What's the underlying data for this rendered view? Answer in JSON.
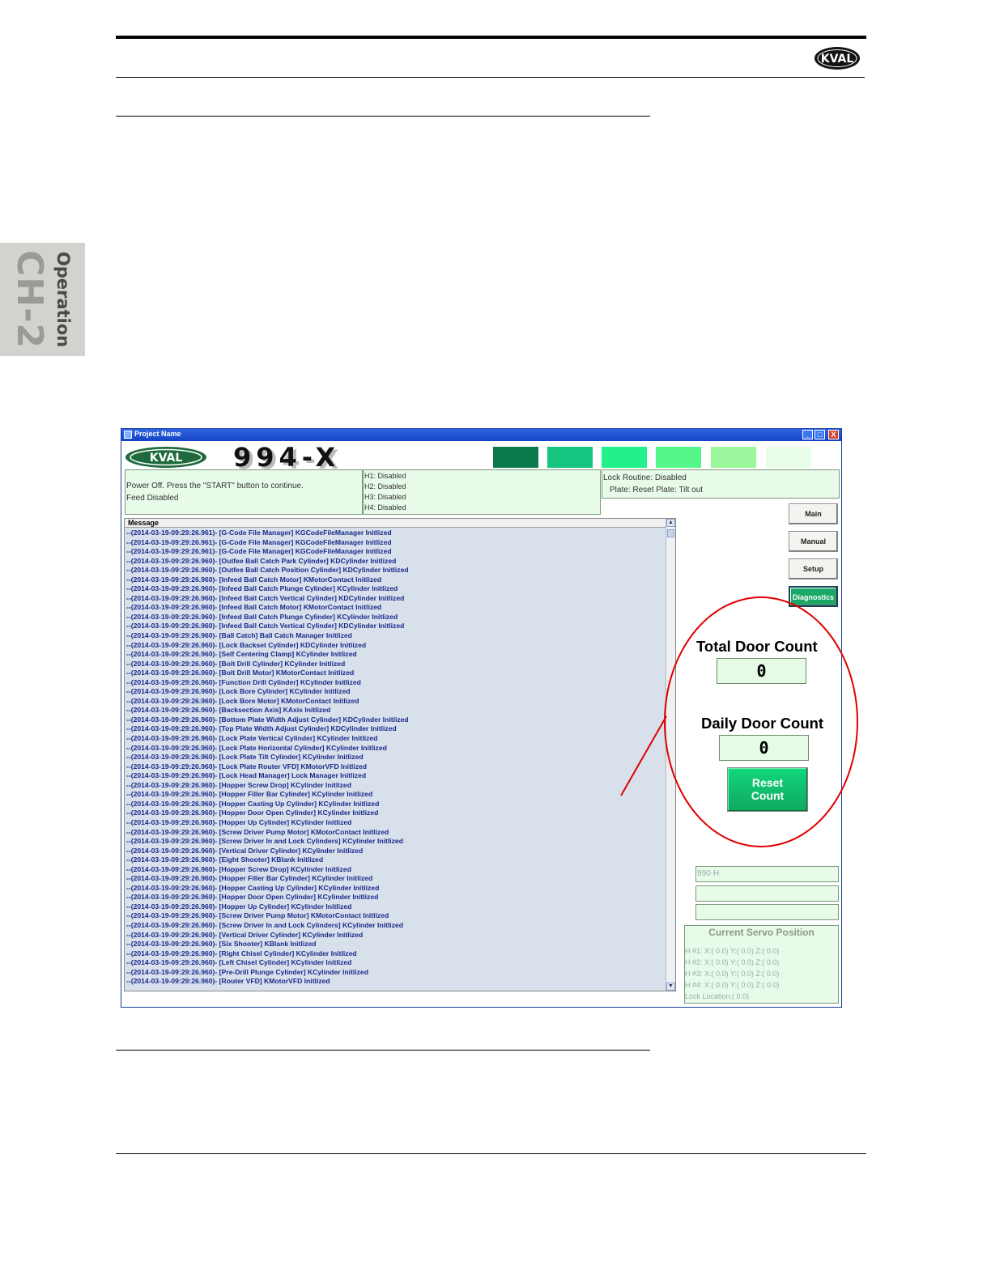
{
  "header": {
    "brand": "KVAL"
  },
  "side_tab": {
    "chapter": "CH-2",
    "section": "Operation"
  },
  "app": {
    "window_title": "Project Name",
    "brand": "KVAL",
    "model": "994-X",
    "swatch_colors": [
      "#0b7a4a",
      "#14c580",
      "#22f08a",
      "#56f78a",
      "#9cf79c",
      "#e8fde8"
    ],
    "window_controls": {
      "minimize": "_",
      "maximize": "□",
      "close": "X"
    },
    "status": {
      "line1": "Power Off. Press the \"START\" button to continue.",
      "line2": "Feed Disabled"
    },
    "heads": [
      "H1: Disabled",
      "H2: Disabled",
      "H3: Disabled",
      "H4: Disabled"
    ],
    "lock": {
      "line1": "Lock Routine: Disabled",
      "line2": "Plate: Reset Plate: Tilt out"
    },
    "message_header": "Message",
    "messages": [
      "--(2014-03-19-09:29:26.961)- [G-Code File Manager] KGCodeFileManager Initlized",
      "--(2014-03-19-09:29:26.961)- [G-Code File Manager] KGCodeFileManager Initlized",
      "--(2014-03-19-09:29:26.961)- [G-Code File Manager] KGCodeFileManager Initlized",
      "--(2014-03-19-09:29:26.960)- [Outfee Ball Catch Park Cylinder] KDCylinder Initlized",
      "--(2014-03-19-09:29:26.960)- [Outfee Ball Catch Position Cylinder] KDCylinder Initlized",
      "--(2014-03-19-09:29:26.960)- [Infeed Ball Catch Motor] KMotorContact Initlized",
      "--(2014-03-19-09:29:26.960)- [Infeed Ball Catch Plunge Cylinder] KCylinder Initlized",
      "--(2014-03-19-09:29:26.960)- [Infeed Ball Catch Vertical Cylinder] KDCylinder Initlized",
      "--(2014-03-19-09:29:26.960)- [Infeed Ball Catch Motor] KMotorContact Initlized",
      "--(2014-03-19-09:29:26.960)- [Infeed Ball Catch Plunge Cylinder] KCylinder Initlized",
      "--(2014-03-19-09:29:26.960)- [Infeed Ball Catch Vertical Cylinder] KDCylinder Initlized",
      "--(2014-03-19-09:29:26.960)- [Ball Catch] Ball Catch Manager Initlized",
      "--(2014-03-19-09:29:26.960)- [Lock Backset Cylinder] KDCylinder Initlized",
      "--(2014-03-19-09:29:26.960)- [Self Centering Clamp] KCylinder Initlized",
      "--(2014-03-19-09:29:26.960)- [Bolt Drill Cylinder] KCylinder Initlized",
      "--(2014-03-19-09:29:26.960)- [Bolt Drill Motor] KMotorContact Initlized",
      "--(2014-03-19-09:29:26.960)- [Function Drill Cylinder] KCylinder Initlized",
      "--(2014-03-19-09:29:26.960)- [Lock Bore Cylinder] KCylinder Initlized",
      "--(2014-03-19-09:29:26.960)- [Lock Bore Motor] KMotorContact Initlized",
      "--(2014-03-19-09:29:26.960)- [Backsection Axis] KAxis Initlized",
      "--(2014-03-19-09:29:26.960)- [Bottom Plate Width Adjust Cylinder] KDCylinder Initlized",
      "--(2014-03-19-09:29:26.960)- [Top Plate Width Adjust Cylinder] KDCylinder Initlized",
      "--(2014-03-19-09:29:26.960)- [Lock Plate Vertical Cylinder] KCylinder Initlized",
      "--(2014-03-19-09:29:26.960)- [Lock Plate Horizontal Cylinder] KCylinder Initlized",
      "--(2014-03-19-09:29:26.960)- [Lock Plate Tilt Cylinder] KCylinder Initlized",
      "--(2014-03-19-09:29:26.960)- [Lock Plate Router VFD] KMotorVFD Initlized",
      "--(2014-03-19-09:29:26.960)- [Lock Head Manager] Lock Manager Initlized",
      "--(2014-03-19-09:29:26.960)- [Hopper Screw Drop] KCylinder Initlized",
      "--(2014-03-19-09:29:26.960)- [Hopper Filler Bar Cylinder] KCylinder Initlized",
      "--(2014-03-19-09:29:26.960)- [Hopper Casting Up Cylinder] KCylinder Initlized",
      "--(2014-03-19-09:29:26.960)- [Hopper Door Open Cylinder] KCylinder Initlized",
      "--(2014-03-19-09:29:26.960)- [Hopper Up Cylinder] KCylinder Initlized",
      "--(2014-03-19-09:29:26.960)- [Screw Driver Pump Motor] KMotorContact Initlized",
      "--(2014-03-19-09:29:26.960)- [Screw Driver In and Lock Cylinders] KCylinder Initlized",
      "--(2014-03-19-09:29:26.960)- [Vertical Driver Cylinder] KCylinder Initlized",
      "--(2014-03-19-09:29:26.960)- [Eight Shooter] KBlank Initlized",
      "--(2014-03-19-09:29:26.960)- [Hopper Screw Drop] KCylinder Initlized",
      "--(2014-03-19-09:29:26.960)- [Hopper Filler Bar Cylinder] KCylinder Initlized",
      "--(2014-03-19-09:29:26.960)- [Hopper Casting Up Cylinder] KCylinder Initlized",
      "--(2014-03-19-09:29:26.960)- [Hopper Door Open Cylinder] KCylinder Initlized",
      "--(2014-03-19-09:29:26.960)- [Hopper Up Cylinder] KCylinder Initlized",
      "--(2014-03-19-09:29:26.960)- [Screw Driver Pump Motor] KMotorContact Initlized",
      "--(2014-03-19-09:29:26.960)- [Screw Driver In and Lock Cylinders] KCylinder Initlized",
      "--(2014-03-19-09:29:26.960)- [Vertical Driver Cylinder] KCylinder Initlized",
      "--(2014-03-19-09:29:26.960)- [Six Shooter] KBlank Initlized",
      "--(2014-03-19-09:29:26.960)- [Right Chisel Cylinder] KCylinder Initlized",
      "--(2014-03-19-09:29:26.960)- [Left Chisel Cylinder] KCylinder Initlized",
      "--(2014-03-19-09:29:26.960)- [Pre-Drill Plunge Cylinder] KCylinder Initlized",
      "--(2014-03-19-09:29:26.960)- [Router VFD] KMotorVFD Initlized"
    ],
    "nav": {
      "main": "Main",
      "manual": "Manual",
      "setup": "Setup",
      "diagnostics": "Diagnostics"
    },
    "total_door_count": {
      "label": "Total Door Count",
      "value": "0"
    },
    "daily_door_count": {
      "label": "Daily Door Count",
      "value": "0"
    },
    "reset_count": "Reset Count",
    "fields": [
      "990-H",
      "",
      ""
    ],
    "servo": {
      "title": "Current Servo Position",
      "lines": [
        "H #1: X:( 0.0) Y:( 0.0) Z:( 0.0)",
        "H #2: X:( 0.0) Y:( 0.0) Z:( 0.0)",
        "H #3: X:( 0.0) Y:( 0.0) Z:( 0.0)",
        "H #4: X:( 0.0) Y:( 0.0) Z:( 0.0)",
        "Lock Location:( 0.0)"
      ]
    }
  }
}
